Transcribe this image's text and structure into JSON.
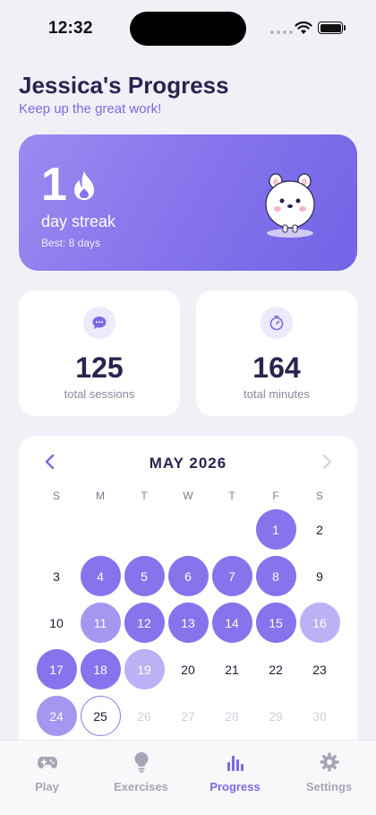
{
  "status_bar": {
    "time": "12:32"
  },
  "header": {
    "title": "Jessica's Progress",
    "subtitle": "Keep up the great work!"
  },
  "streak": {
    "count": "1",
    "label": "day streak",
    "best": "Best: 8 days"
  },
  "stats": [
    {
      "icon": "chat-bubble-icon",
      "value": "125",
      "label": "total sessions"
    },
    {
      "icon": "timer-icon",
      "value": "164",
      "label": "total minutes"
    }
  ],
  "calendar": {
    "month_label": "MAY 2026",
    "weekdays": [
      "S",
      "M",
      "T",
      "W",
      "T",
      "F",
      "S"
    ],
    "first_weekday_index": 5,
    "days": [
      {
        "d": "1",
        "level": 1
      },
      {
        "d": "2",
        "level": 0
      },
      {
        "d": "3",
        "level": 0
      },
      {
        "d": "4",
        "level": 1
      },
      {
        "d": "5",
        "level": 1
      },
      {
        "d": "6",
        "level": 1
      },
      {
        "d": "7",
        "level": 1
      },
      {
        "d": "8",
        "level": 1
      },
      {
        "d": "9",
        "level": 0
      },
      {
        "d": "10",
        "level": 0
      },
      {
        "d": "11",
        "level": 2
      },
      {
        "d": "12",
        "level": 1
      },
      {
        "d": "13",
        "level": 1
      },
      {
        "d": "14",
        "level": 1
      },
      {
        "d": "15",
        "level": 1
      },
      {
        "d": "16",
        "level": 3
      },
      {
        "d": "17",
        "level": 1
      },
      {
        "d": "18",
        "level": 1
      },
      {
        "d": "19",
        "level": 3
      },
      {
        "d": "20",
        "level": 0
      },
      {
        "d": "21",
        "level": 0
      },
      {
        "d": "22",
        "level": 0
      },
      {
        "d": "23",
        "level": 0
      },
      {
        "d": "24",
        "level": 2
      },
      {
        "d": "25",
        "level": 0,
        "today": true
      },
      {
        "d": "26",
        "level": 0,
        "future": true
      },
      {
        "d": "27",
        "level": 0,
        "future": true
      },
      {
        "d": "28",
        "level": 0,
        "future": true
      },
      {
        "d": "29",
        "level": 0,
        "future": true
      },
      {
        "d": "30",
        "level": 0,
        "future": true
      }
    ],
    "colors": {
      "level1": "#8574EC",
      "level2": "#A497F1",
      "level3": "#BBB2F5"
    }
  },
  "tabs": [
    {
      "label": "Play",
      "icon": "gamepad-icon",
      "active": false
    },
    {
      "label": "Exercises",
      "icon": "lightbulb-icon",
      "active": false
    },
    {
      "label": "Progress",
      "icon": "bar-chart-icon",
      "active": true
    },
    {
      "label": "Settings",
      "icon": "gear-icon",
      "active": false
    }
  ],
  "accent_color": "#7A6AE0"
}
